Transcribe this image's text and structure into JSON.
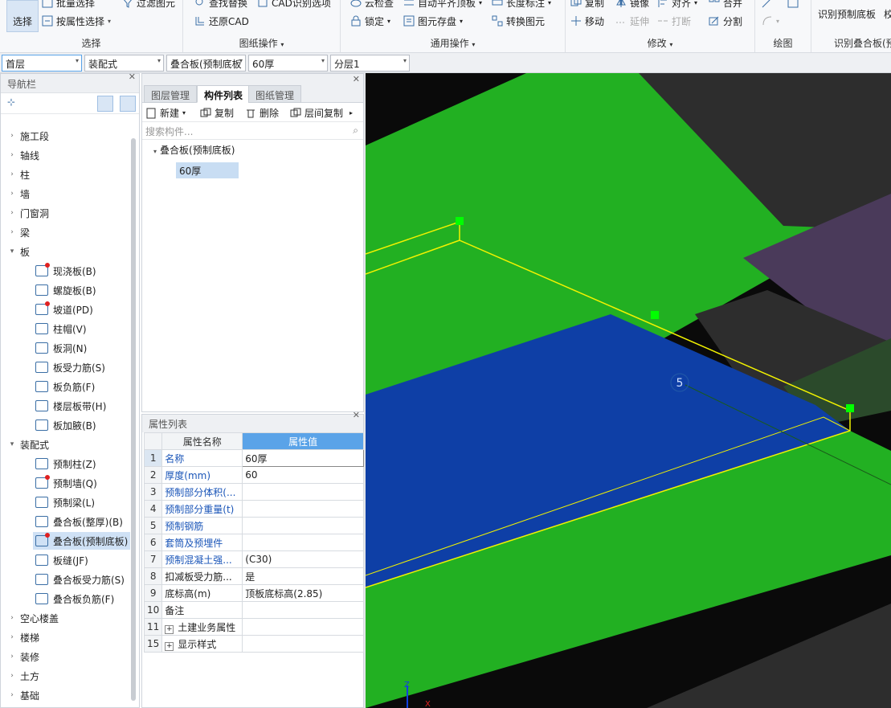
{
  "ribbon": {
    "select": {
      "big_label": "选择",
      "batch": "批量选择",
      "by_attr": "按属性选择",
      "filter": "过滤图元",
      "title": "选择"
    },
    "drawing_ops": {
      "find_replace": "查找替换",
      "cad_recognize": "CAD识别选项",
      "restore_cad": "还原CAD",
      "title": "图纸操作"
    },
    "common_ops": {
      "cloud_check": "云检查",
      "auto_flush": "自动平齐顶板",
      "length_mark": "长度标注",
      "lock": "锁定",
      "save_cad": "图元存盘",
      "convert": "转换图元",
      "title": "通用操作"
    },
    "modify": {
      "copy": "复制",
      "mirror": "镜像",
      "align": "对齐",
      "merge": "合并",
      "move": "移动",
      "extend": "延伸",
      "break": "打断",
      "split": "分割",
      "title": "修改"
    },
    "draw": {
      "title": "绘图"
    },
    "recognize": {
      "recognize_slab": "识别预制底板",
      "more": "校",
      "title": "识别叠合板(预"
    }
  },
  "selectors": {
    "floor": "首层",
    "category": "装配式",
    "type": "叠合板(预制底板",
    "spec": "60厚",
    "layer": "分层1"
  },
  "nav": {
    "title": "导航栏",
    "groups": [
      {
        "label": "施工段"
      },
      {
        "label": "轴线"
      },
      {
        "label": "柱"
      },
      {
        "label": "墙"
      },
      {
        "label": "门窗洞"
      },
      {
        "label": "梁"
      },
      {
        "label": "板"
      }
    ],
    "slab_items": [
      {
        "label": "现浇板(B)"
      },
      {
        "label": "螺旋板(B)"
      },
      {
        "label": "坡道(PD)"
      },
      {
        "label": "柱帽(V)"
      },
      {
        "label": "板洞(N)"
      },
      {
        "label": "板受力筋(S)"
      },
      {
        "label": "板负筋(F)"
      },
      {
        "label": "楼层板带(H)"
      },
      {
        "label": "板加腋(B)"
      }
    ],
    "assembly_label": "装配式",
    "assembly_items": [
      {
        "label": "预制柱(Z)"
      },
      {
        "label": "预制墙(Q)"
      },
      {
        "label": "预制梁(L)"
      },
      {
        "label": "叠合板(整厚)(B)"
      },
      {
        "label": "叠合板(预制底板)"
      },
      {
        "label": "板缝(JF)"
      },
      {
        "label": "叠合板受力筋(S)"
      },
      {
        "label": "叠合板负筋(F)"
      }
    ],
    "bottom_groups": [
      {
        "label": "空心楼盖"
      },
      {
        "label": "楼梯"
      },
      {
        "label": "装修"
      },
      {
        "label": "土方"
      },
      {
        "label": "基础"
      }
    ]
  },
  "component_panel": {
    "tabs": [
      "图层管理",
      "构件列表",
      "图纸管理"
    ],
    "tools": {
      "new": "新建",
      "copy": "复制",
      "delete": "删除",
      "floor_copy": "层间复制"
    },
    "search_placeholder": "搜索构件...",
    "tree_root": "叠合板(预制底板)",
    "tree_child": "60厚"
  },
  "property_panel": {
    "title": "属性列表",
    "col_name": "属性名称",
    "col_value": "属性值",
    "rows": [
      {
        "no": "1",
        "name": "名称",
        "value": "60厚"
      },
      {
        "no": "2",
        "name": "厚度(mm)",
        "value": "60"
      },
      {
        "no": "3",
        "name": "预制部分体积(...",
        "value": ""
      },
      {
        "no": "4",
        "name": "预制部分重量(t)",
        "value": ""
      },
      {
        "no": "5",
        "name": "预制钢筋",
        "value": ""
      },
      {
        "no": "6",
        "name": "套筒及预埋件",
        "value": ""
      },
      {
        "no": "7",
        "name": "预制混凝土强...",
        "value": "(C30)"
      },
      {
        "no": "8",
        "name": "扣减板受力筋...",
        "value": "是"
      },
      {
        "no": "9",
        "name": "底标高(m)",
        "value": "顶板底标高(2.85)"
      },
      {
        "no": "10",
        "name": "备注",
        "value": ""
      },
      {
        "no": "11",
        "name": "土建业务属性",
        "value": ""
      },
      {
        "no": "15",
        "name": "显示样式",
        "value": ""
      }
    ]
  },
  "viewport": {
    "axis_number": "5",
    "axis_z": "Z",
    "axis_x": "X"
  },
  "colors": {
    "accent": "#5aa3e8",
    "slab_green": "#22b022",
    "slab_blue": "#0e3fa6",
    "highlight_yellow": "#f2f200",
    "grip_green": "#00ff00"
  }
}
